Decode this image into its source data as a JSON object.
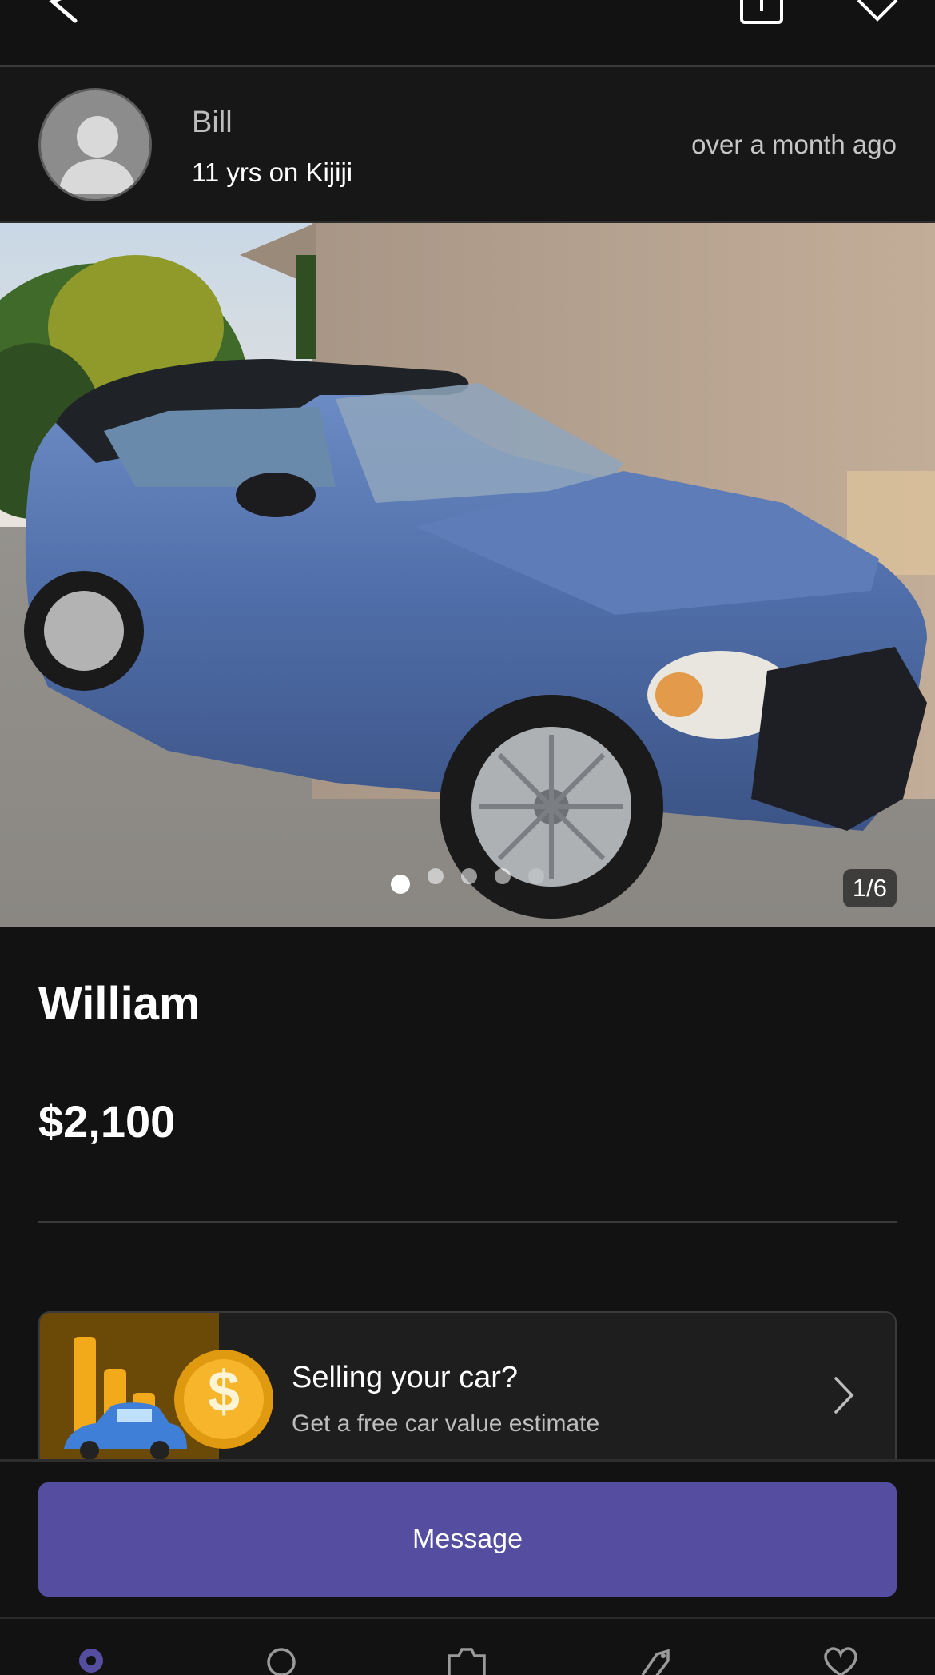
{
  "seller": {
    "name": "Bill",
    "tenure": "11 yrs on Kijiji",
    "posted": "over a month  ago"
  },
  "gallery": {
    "counter": "1/6",
    "dots": 5,
    "active_dot": 0
  },
  "listing": {
    "title": "William",
    "price": "$2,100"
  },
  "promo": {
    "title": "Selling your car?",
    "subtitle": "Get a free car value estimate"
  },
  "actions": {
    "message_label": "Message"
  },
  "colors": {
    "accent": "#544da0",
    "background": "#121212",
    "promo_art": "#6b4a07"
  },
  "icons": {
    "back": "back-arrow-icon",
    "share": "share-icon",
    "favorite": "heart-icon",
    "promo_chevron": "chevron-right-icon",
    "tabs": [
      "home-icon",
      "search-icon",
      "camera-icon",
      "tag-icon",
      "heart-icon"
    ]
  }
}
